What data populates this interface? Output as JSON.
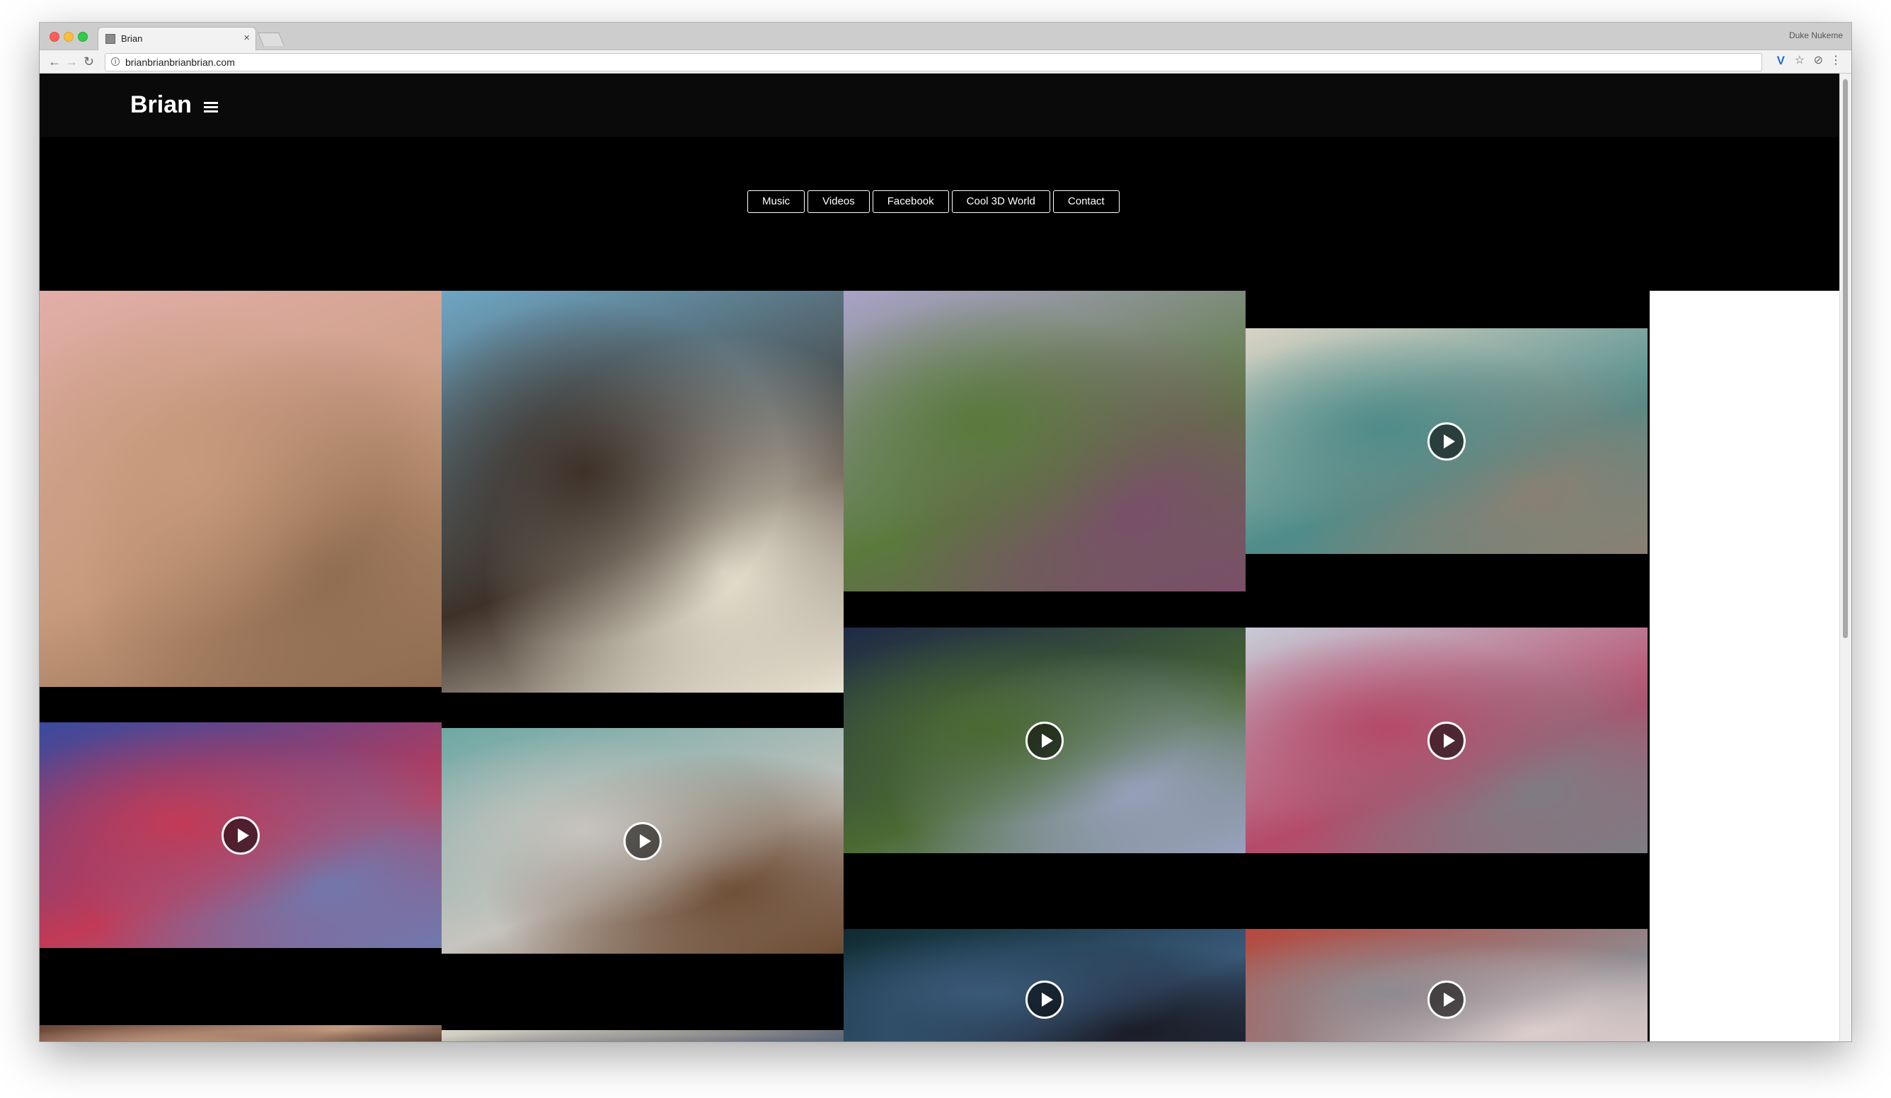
{
  "browser": {
    "tab_title": "Brian",
    "tab_close": "×",
    "profile_name": "Duke Nukeme",
    "url": "brianbrianbrianbrian.com",
    "nav": {
      "back": "←",
      "forward": "→",
      "reload": "↻"
    },
    "extensions": {
      "v": "V",
      "star": "☆",
      "block": "⊘",
      "menu": "⋮"
    }
  },
  "site": {
    "brand": "Brian",
    "menu": [
      "Music",
      "Videos",
      "Facebook",
      "Cool 3D World",
      "Contact"
    ]
  },
  "gallery": {
    "tiles": [
      {
        "id": "bearded-man-holding-tree",
        "video": false,
        "colors": [
          "#e2aea8",
          "#c79a7c",
          "#8e6b4f"
        ]
      },
      {
        "id": "coffee-bean-pool-umbrella",
        "video": false,
        "colors": [
          "#6ea6c4",
          "#3e3128",
          "#e9e3d2"
        ]
      },
      {
        "id": "chrome-arches-park",
        "video": false,
        "colors": [
          "#a9a2c6",
          "#5a7a3c",
          "#7a4e6a"
        ]
      },
      {
        "id": "blue-figure-seesaw",
        "video": true,
        "colors": [
          "#d9d4c5",
          "#4f8c8a",
          "#8a8072"
        ]
      },
      {
        "id": "hanuman-faces-red-glow",
        "video": true,
        "colors": [
          "#3a4a9e",
          "#c23a56",
          "#6e7ab0"
        ]
      },
      {
        "id": "hand-with-faces",
        "video": true,
        "colors": [
          "#6fa8a4",
          "#c7c4bf",
          "#6b4a32"
        ]
      },
      {
        "id": "night-swamp-glow",
        "video": true,
        "colors": [
          "#1f2a45",
          "#4a6a32",
          "#9aa2c0"
        ]
      },
      {
        "id": "head-on-pole-plaza",
        "video": true,
        "colors": [
          "#c7cbd6",
          "#b54a6a",
          "#7d7e84"
        ]
      },
      {
        "id": "wave-bottom-partial",
        "video": false,
        "colors": [
          "#6a4638",
          "#c29a80",
          "#3a2620"
        ]
      },
      {
        "id": "room-bottom-partial",
        "video": false,
        "colors": [
          "#d8d4c8",
          "#8a8a8a",
          "#3d4a6a"
        ]
      },
      {
        "id": "dark-water-creature",
        "video": true,
        "colors": [
          "#0f2a30",
          "#3a5a7a",
          "#1a1a24"
        ]
      },
      {
        "id": "silver-face-red-bg",
        "video": true,
        "colors": [
          "#b5483e",
          "#8e8a90",
          "#e0d0d0"
        ]
      }
    ]
  }
}
